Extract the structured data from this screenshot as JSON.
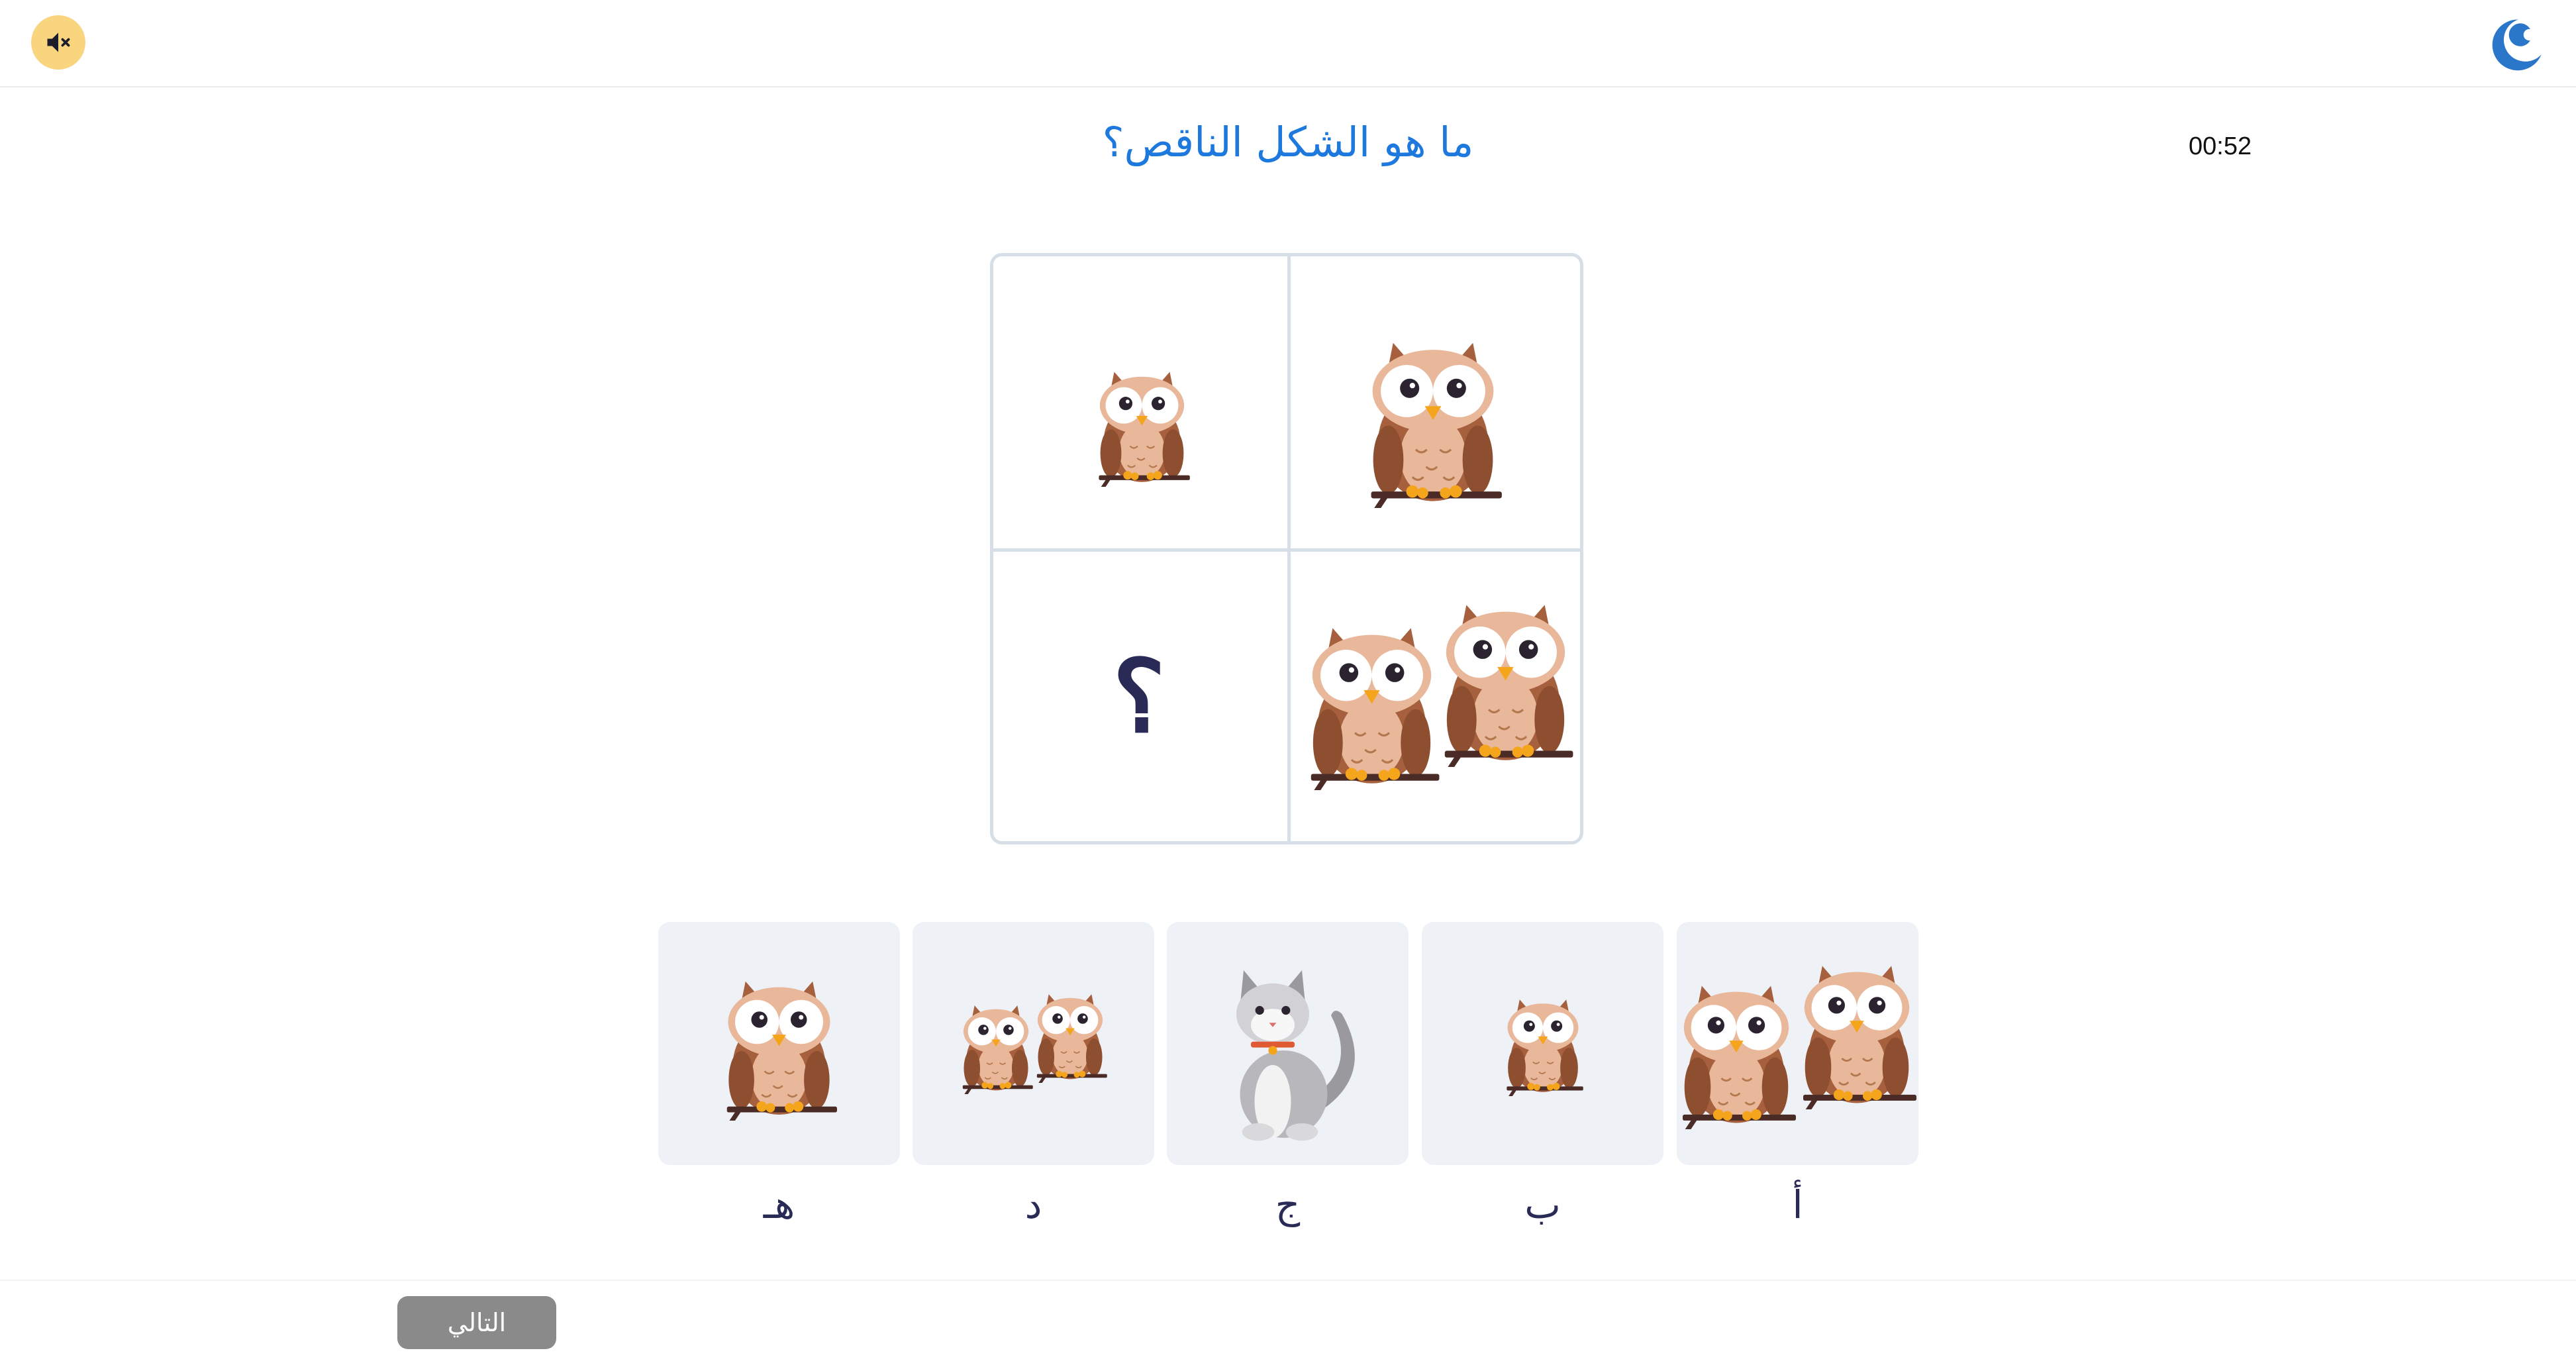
{
  "header": {
    "mute_icon": "speaker-muted-icon",
    "logo_icon": "app-logo-icon",
    "colors": {
      "mute_bg": "#f9d57e",
      "logo_blue": "#2a77c9"
    }
  },
  "question": {
    "text": "ما هو الشكل الناقص؟"
  },
  "timer": {
    "value": "00:52"
  },
  "puzzle": {
    "missing_mark": "؟",
    "cells": [
      {
        "position": "top-right",
        "content": "large owl",
        "count": 1
      },
      {
        "position": "top-left",
        "content": "small owl",
        "count": 1
      },
      {
        "position": "bottom-right",
        "content": "large owls",
        "count": 2
      },
      {
        "position": "bottom-left",
        "content": "missing",
        "count": 0
      }
    ]
  },
  "options": [
    {
      "label": "أ",
      "content": "two large owls"
    },
    {
      "label": "ب",
      "content": "one small owl"
    },
    {
      "label": "ج",
      "content": "grey cat"
    },
    {
      "label": "د",
      "content": "two small owls"
    },
    {
      "label": "هـ",
      "content": "one medium owl"
    }
  ],
  "footer": {
    "next_label": "التالي"
  },
  "colors": {
    "accent": "#1e79de",
    "option_bg": "#eef1f6",
    "grid_border": "#d6dfe8",
    "next_bg": "#8a8a8a"
  }
}
